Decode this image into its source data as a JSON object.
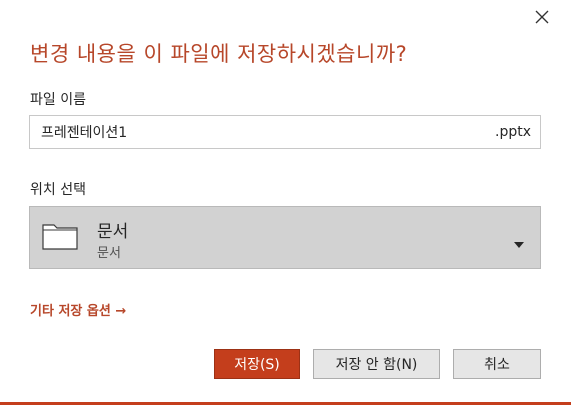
{
  "dialog": {
    "title": "변경 내용을 이 파일에 저장하시겠습니까?",
    "close_icon": "close-icon"
  },
  "filename": {
    "label": "파일 이름",
    "value": "프레젠테이션1",
    "extension": ".pptx"
  },
  "location": {
    "label": "위치 선택",
    "main": "문서",
    "sub": "문서",
    "icon": "folder-icon",
    "dropdown_icon": "caret-down-icon"
  },
  "more_options": {
    "label": "기타 저장 옵션 →"
  },
  "buttons": {
    "save": "저장(S)",
    "dont_save": "저장 안 함(N)",
    "cancel": "취소"
  },
  "colors": {
    "accent": "#b7472a",
    "primary_button": "#c43e1c",
    "location_bg": "#d2d2d2"
  }
}
